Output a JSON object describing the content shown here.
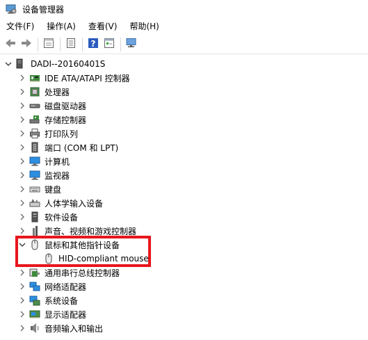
{
  "window": {
    "title": "设备管理器"
  },
  "menu": [
    "文件(F)",
    "操作(A)",
    "查看(V)",
    "帮助(H)"
  ],
  "toolbar": [
    {
      "name": "back-icon"
    },
    {
      "name": "forward-icon"
    },
    {
      "sep": true
    },
    {
      "name": "properties-icon"
    },
    {
      "sep": true
    },
    {
      "name": "update-driver-icon"
    },
    {
      "sep": true
    },
    {
      "name": "help-icon"
    },
    {
      "name": "show-hidden-icon"
    },
    {
      "sep": true
    },
    {
      "name": "scan-hardware-icon"
    }
  ],
  "tree": {
    "root": "DADI--20160401S",
    "categories": [
      {
        "label": "IDE ATA/ATAPI 控制器",
        "icon": "ide-controller-icon"
      },
      {
        "label": "处理器",
        "icon": "processor-icon"
      },
      {
        "label": "磁盘驱动器",
        "icon": "disk-drive-icon"
      },
      {
        "label": "存储控制器",
        "icon": "storage-controller-icon"
      },
      {
        "label": "打印队列",
        "icon": "printer-icon"
      },
      {
        "label": "端口 (COM 和 LPT)",
        "icon": "port-icon"
      },
      {
        "label": "计算机",
        "icon": "computer-icon"
      },
      {
        "label": "监视器",
        "icon": "monitor-icon"
      },
      {
        "label": "键盘",
        "icon": "keyboard-icon"
      },
      {
        "label": "人体学输入设备",
        "icon": "hid-icon"
      },
      {
        "label": "软件设备",
        "icon": "software-device-icon"
      },
      {
        "label": "声音、视频和游戏控制器",
        "icon": "sound-icon"
      },
      {
        "label": "鼠标和其他指针设备",
        "icon": "mouse-icon",
        "expanded": true,
        "children": [
          {
            "label": "HID-compliant mouse",
            "icon": "mouse-icon"
          }
        ]
      },
      {
        "label": "通用串行总线控制器",
        "icon": "usb-icon"
      },
      {
        "label": "网络适配器",
        "icon": "network-adapter-icon"
      },
      {
        "label": "系统设备",
        "icon": "system-device-icon"
      },
      {
        "label": "显示适配器",
        "icon": "display-adapter-icon"
      },
      {
        "label": "音频输入和输出",
        "icon": "audio-io-icon"
      }
    ]
  },
  "colors": {
    "highlight": "#e8161c",
    "accent": "#1e88e5"
  }
}
